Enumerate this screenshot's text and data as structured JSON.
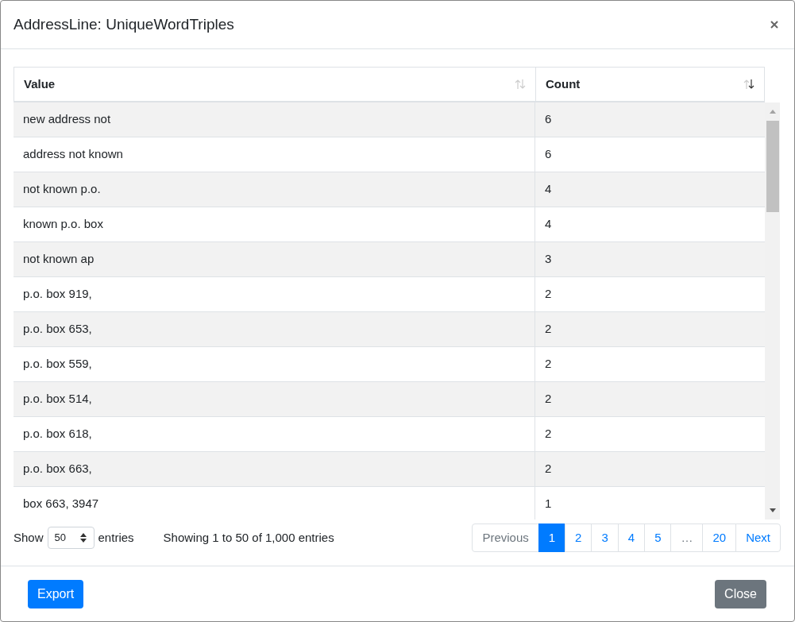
{
  "dialog": {
    "title": "AddressLine: UniqueWordTriples"
  },
  "table": {
    "columns": [
      {
        "label": "Value",
        "sorted_descending": false
      },
      {
        "label": "Count",
        "sorted_descending": true
      }
    ],
    "rows": [
      [
        "new address not",
        "6"
      ],
      [
        "address not known",
        "6"
      ],
      [
        "not known p.o.",
        "4"
      ],
      [
        "known p.o. box",
        "4"
      ],
      [
        "not known ap",
        "3"
      ],
      [
        "p.o. box 919,",
        "2"
      ],
      [
        "p.o. box 653,",
        "2"
      ],
      [
        "p.o. box 559,",
        "2"
      ],
      [
        "p.o. box 514,",
        "2"
      ],
      [
        "p.o. box 618,",
        "2"
      ],
      [
        "p.o. box 663,",
        "2"
      ],
      [
        "box 663, 3947",
        "1"
      ]
    ]
  },
  "length_menu": {
    "label_before": "Show",
    "value": "50",
    "label_after": "entries"
  },
  "info": "Showing 1 to 50 of 1,000 entries",
  "pagination": [
    {
      "label": "Previous",
      "selected": false,
      "disabled": true
    },
    {
      "label": "1",
      "selected": true,
      "disabled": false
    },
    {
      "label": "2",
      "selected": false,
      "disabled": false
    },
    {
      "label": "3",
      "selected": false,
      "disabled": false
    },
    {
      "label": "4",
      "selected": false,
      "disabled": false
    },
    {
      "label": "5",
      "selected": false,
      "disabled": false
    },
    {
      "label": "…",
      "selected": false,
      "disabled": true
    },
    {
      "label": "20",
      "selected": false,
      "disabled": false
    },
    {
      "label": "Next",
      "selected": false,
      "disabled": false
    }
  ],
  "buttons": [
    {
      "label": "Export",
      "kind": "primary"
    },
    {
      "label": "Close",
      "kind": "secondary"
    }
  ]
}
